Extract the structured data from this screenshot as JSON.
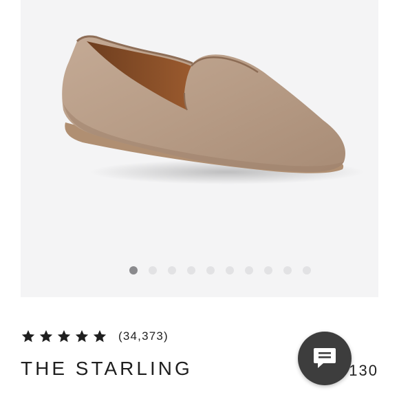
{
  "gallery": {
    "image_alt": "Tan suede loafer",
    "slide_count": 10,
    "active_slide": 1
  },
  "product": {
    "rating_stars": 5,
    "review_count": "(34,373)",
    "name": "THE STARLING",
    "price_visible": "130"
  },
  "colors": {
    "gallery_bg": "#f4f4f5",
    "dot_active": "#8a8a8d",
    "dot_inactive": "#e2e2e4",
    "chat_bg": "#3d3d3d",
    "text": "#1f1f1f"
  },
  "chat": {
    "icon": "chat-bubble-icon"
  }
}
